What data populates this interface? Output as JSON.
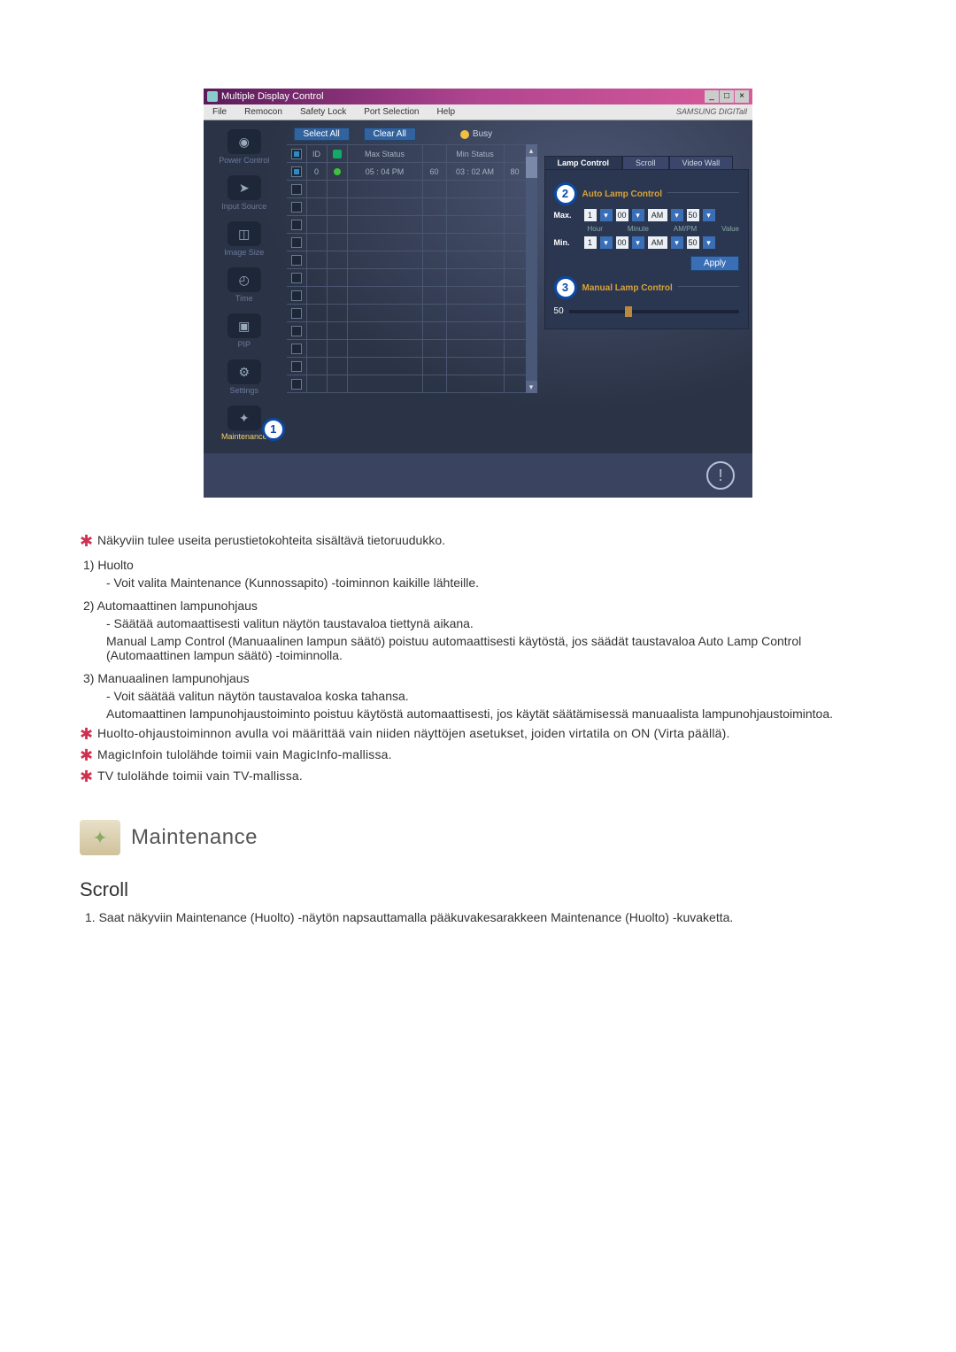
{
  "app": {
    "title": "Multiple Display Control",
    "brand": "SAMSUNG DIGITall",
    "menu": [
      "File",
      "Remocon",
      "Safety Lock",
      "Port Selection",
      "Help"
    ],
    "win_buttons": [
      "_",
      "□",
      "×"
    ]
  },
  "sidebar": [
    {
      "label": "Power Control",
      "icon": "◉"
    },
    {
      "label": "Input Source",
      "icon": "➤"
    },
    {
      "label": "Image Size",
      "icon": "◫"
    },
    {
      "label": "Time",
      "icon": "◴"
    },
    {
      "label": "PIP",
      "icon": "▣"
    },
    {
      "label": "Settings",
      "icon": "⚙"
    },
    {
      "label": "Maintenance",
      "icon": "✦",
      "active": true,
      "callout": "1"
    }
  ],
  "toolbar": {
    "select_all": "Select All",
    "clear_all": "Clear All",
    "busy": "Busy"
  },
  "grid": {
    "headers": {
      "chk": "☑",
      "id": "ID",
      "st": "",
      "max": "Max Status",
      "maxv": "",
      "min": "Min Status",
      "minv": ""
    },
    "row1": {
      "id": "0",
      "max": "05 : 04 PM",
      "maxv": "60",
      "min": "03 : 02 AM",
      "minv": "80"
    },
    "empty_rows": 12
  },
  "tabs": {
    "lamp": "Lamp Control",
    "scroll": "Scroll",
    "videowall": "Video Wall"
  },
  "auto_lamp": {
    "callout": "2",
    "title": "Auto Lamp Control",
    "max_label": "Max.",
    "min_label": "Min.",
    "hour": "1",
    "minute": "00",
    "ampm": "AM",
    "value": "50",
    "sublabels": [
      "Hour",
      "Minute",
      "AM/PM",
      "Value"
    ],
    "apply": "Apply"
  },
  "manual_lamp": {
    "callout": "3",
    "title": "Manual Lamp Control",
    "value": "50"
  },
  "doc": {
    "star1": "Näkyviin tulee useita perustietokohteita sisältävä tietoruudukko.",
    "h1": "1)  Huolto",
    "h1_d1": "- Voit valita Maintenance (Kunnossapito) -toiminnon kaikille lähteille.",
    "h2": "2)  Automaattinen lampunohjaus",
    "h2_d1": "- Säätää automaattisesti valitun näytön taustavaloa tiettynä aikana.",
    "h2_c1": "Manual Lamp Control (Manuaalinen lampun säätö) poistuu automaattisesti käytöstä, jos säädät taustavaloa Auto Lamp Control (Automaattinen lampun säätö) -toiminnolla.",
    "h3": "3)  Manuaalinen lampunohjaus",
    "h3_d1": "- Voit säätää valitun näytön taustavaloa koska tahansa.",
    "h3_c1": "Automaattinen lampunohjaustoiminto poistuu käytöstä automaattisesti, jos käytät säätämisessä manuaalista lampunohjaustoimintoa.",
    "star2": "Huolto-ohjaustoiminnon avulla voi määrittää vain niiden näyttöjen asetukset, joiden virtatila on ON (Virta päällä).",
    "star3": "MagicInfoin tulolähde toimii vain MagicInfo-mallissa.",
    "star4": "TV tulolähde toimii vain TV-mallissa.",
    "maint_title": "Maintenance",
    "scroll_title": "Scroll",
    "step1": "1.  Saat näkyviin Maintenance (Huolto) -näytön napsauttamalla pääkuvakesarakkeen Maintenance (Huolto) -kuvaketta."
  }
}
